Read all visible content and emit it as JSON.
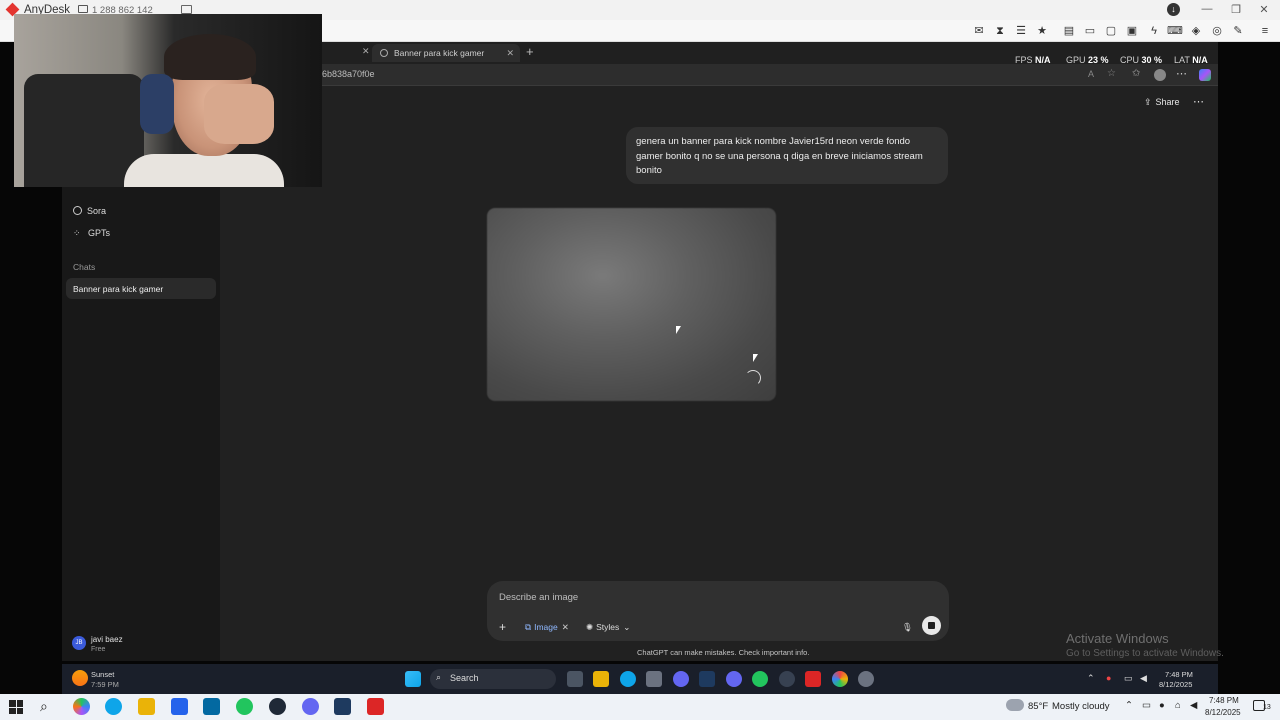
{
  "anydesk": {
    "app_name": "AnyDesk",
    "session_id": "1 288 862 142",
    "stats": {
      "fps_label": "FPS",
      "fps_value": "N/A",
      "gpu_label": "GPU",
      "gpu_value": "23 %",
      "cpu_label": "CPU",
      "cpu_value": "30 %",
      "lat_label": "LAT",
      "lat_value": "N/A"
    }
  },
  "browser": {
    "active_tab_title": "Banner para kick gamer",
    "url_fragment": "6b838a70f0e"
  },
  "sidebar": {
    "items": [
      {
        "label": "Sora"
      },
      {
        "label": "GPTs"
      }
    ],
    "chats_label": "Chats",
    "active_chat": "Banner para kick gamer",
    "user_name": "javi baez",
    "user_plan": "Free",
    "user_initials": "JB"
  },
  "chat": {
    "share_label": "Share",
    "user_message": "genera un banner para kick nombre Javier15rd neon verde fondo gamer bonito q no se una persona q diga en breve iniciamos stream bonito",
    "composer_placeholder": "Describe an image",
    "image_chip": "Image",
    "styles_chip": "Styles",
    "disclaimer": "ChatGPT can make mistakes. Check important info."
  },
  "watermark": {
    "line1": "Activate Windows",
    "line2": "Go to Settings to activate Windows."
  },
  "remote_taskbar": {
    "weather_title": "Sunset",
    "weather_time": "7:59 PM",
    "search_label": "Search",
    "clock_time": "7:48 PM",
    "clock_date": "8/12/2025"
  },
  "local_taskbar": {
    "weather": "85°F",
    "condition": "Mostly cloudy",
    "clock_time": "7:48 PM",
    "clock_date": "8/12/2025",
    "notification_count": "13"
  },
  "colors": {
    "anydesk_red": "#e3342f",
    "chat_bg": "#212121",
    "sidebar_bg": "#181818",
    "bubble_bg": "#303030"
  }
}
